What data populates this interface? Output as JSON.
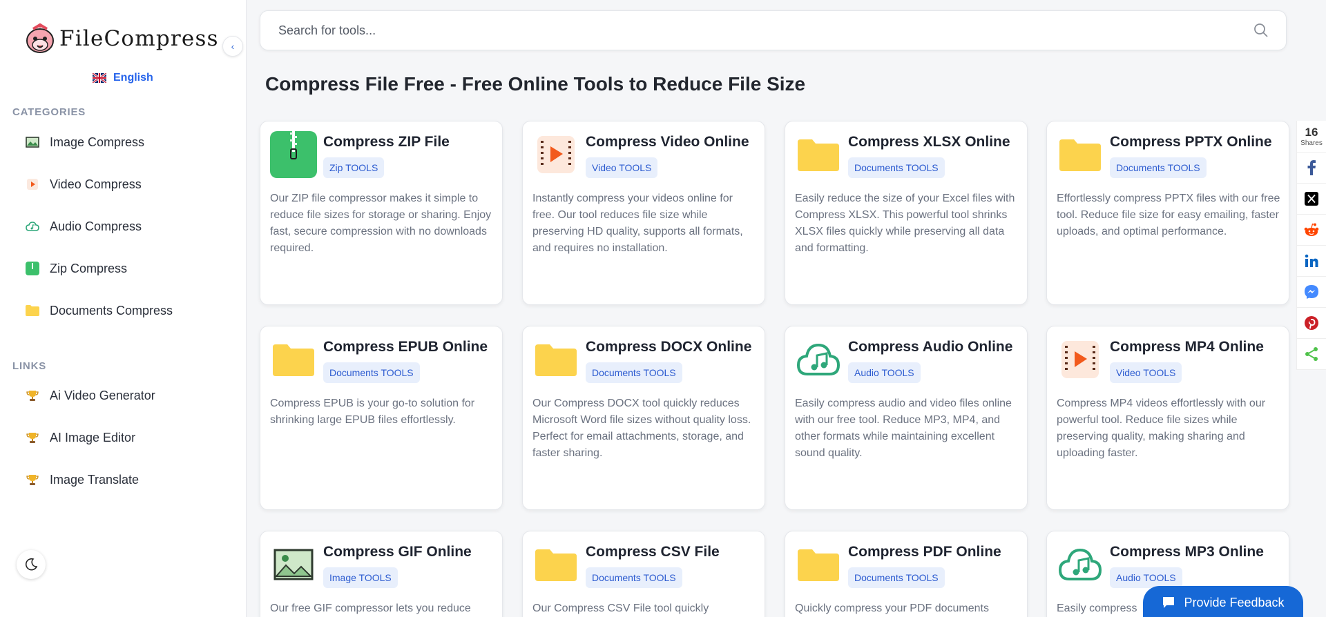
{
  "brand": {
    "name": "FileCompress"
  },
  "language": {
    "label": "English"
  },
  "sidebar": {
    "categories_title": "CATEGORIES",
    "categories": [
      {
        "label": "Image Compress",
        "icon": "image-icon"
      },
      {
        "label": "Video Compress",
        "icon": "video-icon"
      },
      {
        "label": "Audio Compress",
        "icon": "audio-cloud-icon"
      },
      {
        "label": "Zip Compress",
        "icon": "zip-icon"
      },
      {
        "label": "Documents Compress",
        "icon": "folder-icon"
      }
    ],
    "links_title": "LINKS",
    "links": [
      {
        "label": "Ai Video Generator",
        "icon": "trophy-icon"
      },
      {
        "label": "AI Image Editor",
        "icon": "trophy-icon"
      },
      {
        "label": "Image Translate",
        "icon": "trophy-icon"
      }
    ]
  },
  "search": {
    "placeholder": "Search for tools..."
  },
  "page": {
    "title": "Compress File Free - Free Online Tools to Reduce File Size"
  },
  "tools": [
    {
      "title": "Compress ZIP File",
      "badge": "Zip TOOLS",
      "icon": "zip-icon",
      "desc": "Our ZIP file compressor makes it simple to reduce file sizes for storage or sharing. Enjoy fast, secure compression with no downloads required."
    },
    {
      "title": "Compress Video Online",
      "badge": "Video TOOLS",
      "icon": "video-icon",
      "desc": "Instantly compress your videos online for free. Our tool reduces file size while preserving HD quality, supports all formats, and requires no installation."
    },
    {
      "title": "Compress XLSX Online",
      "badge": "Documents TOOLS",
      "icon": "folder-icon",
      "desc": "Easily reduce the size of your Excel files with Compress XLSX. This powerful tool shrinks XLSX files quickly while preserving all data and formatting."
    },
    {
      "title": "Compress PPTX Online",
      "badge": "Documents TOOLS",
      "icon": "folder-icon",
      "desc": "Effortlessly compress PPTX files with our free tool. Reduce file size for easy emailing, faster uploads, and optimal performance."
    },
    {
      "title": "Compress EPUB Online",
      "badge": "Documents TOOLS",
      "icon": "folder-icon",
      "desc": "Compress EPUB is your go-to solution for shrinking large EPUB files effortlessly."
    },
    {
      "title": "Compress DOCX Online",
      "badge": "Documents TOOLS",
      "icon": "folder-icon",
      "desc": "Our Compress DOCX tool quickly reduces Microsoft Word file sizes without quality loss. Perfect for email attachments, storage, and faster sharing."
    },
    {
      "title": "Compress Audio Online",
      "badge": "Audio TOOLS",
      "icon": "audio-cloud-icon",
      "desc": "Easily compress audio and video files online with our free tool. Reduce MP3, MP4, and other formats while maintaining excellent sound quality."
    },
    {
      "title": "Compress MP4 Online",
      "badge": "Video TOOLS",
      "icon": "video-icon",
      "desc": "Compress MP4 videos effortlessly with our powerful tool. Reduce file sizes while preserving quality, making sharing and uploading faster."
    },
    {
      "title": "Compress GIF Online",
      "badge": "Image TOOLS",
      "icon": "image-icon",
      "desc": "Our free GIF compressor lets you reduce"
    },
    {
      "title": "Compress CSV File",
      "badge": "Documents TOOLS",
      "icon": "folder-icon",
      "desc": "Our Compress CSV File tool quickly"
    },
    {
      "title": "Compress PDF Online",
      "badge": "Documents TOOLS",
      "icon": "folder-icon",
      "desc": "Quickly compress your PDF documents"
    },
    {
      "title": "Compress MP3 Online",
      "badge": "Audio TOOLS",
      "icon": "audio-cloud-icon",
      "desc": "Easily compress"
    }
  ],
  "share": {
    "count": "16",
    "count_label": "Shares",
    "buttons": [
      {
        "name": "facebook",
        "color": "#3b5998"
      },
      {
        "name": "x",
        "color": "#000000"
      },
      {
        "name": "reddit",
        "color": "#ff4500"
      },
      {
        "name": "linkedin",
        "color": "#0a66c2"
      },
      {
        "name": "messenger",
        "color": "#448aff"
      },
      {
        "name": "pinterest",
        "color": "#cb2027"
      },
      {
        "name": "sharethis",
        "color": "#4fc24a"
      }
    ]
  },
  "feedback": {
    "label": "Provide Feedback"
  },
  "colors": {
    "accent": "#2563eb",
    "feedback": "#1668d6",
    "badge_bg": "#e8effc",
    "badge_text": "#2c5bd0"
  }
}
